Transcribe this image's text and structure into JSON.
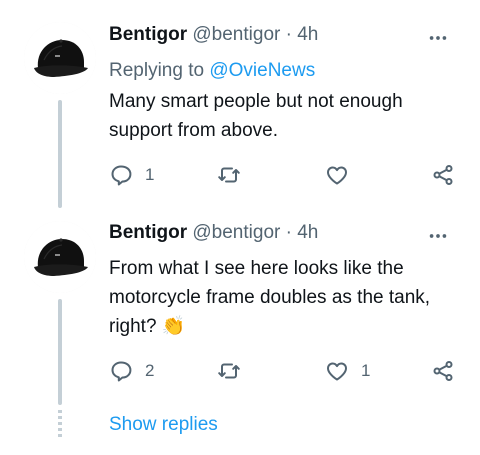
{
  "tweets": [
    {
      "name": "Bentigor",
      "handle": "@bentigor",
      "separator": "·",
      "time": "4h",
      "replying_prefix": "Replying to",
      "replying_mention": "@OvieNews",
      "text": "Many smart people but not enough support from above.",
      "actions": {
        "reply_count": "1",
        "retweet_count": "",
        "like_count": ""
      },
      "avatar_icon": "cap-icon"
    },
    {
      "name": "Bentigor",
      "handle": "@bentigor",
      "separator": "·",
      "time": "4h",
      "text": "From what I see here looks like the motorcycle frame doubles as the tank, right?",
      "emoji": "👏",
      "actions": {
        "reply_count": "2",
        "retweet_count": "",
        "like_count": "1"
      },
      "avatar_icon": "cap-icon"
    }
  ],
  "show_replies_label": "Show replies",
  "colors": {
    "accent": "#1d9bf0",
    "secondary_text": "#536471",
    "primary_text": "#0f1419",
    "thread_line": "#c4cfd6"
  }
}
